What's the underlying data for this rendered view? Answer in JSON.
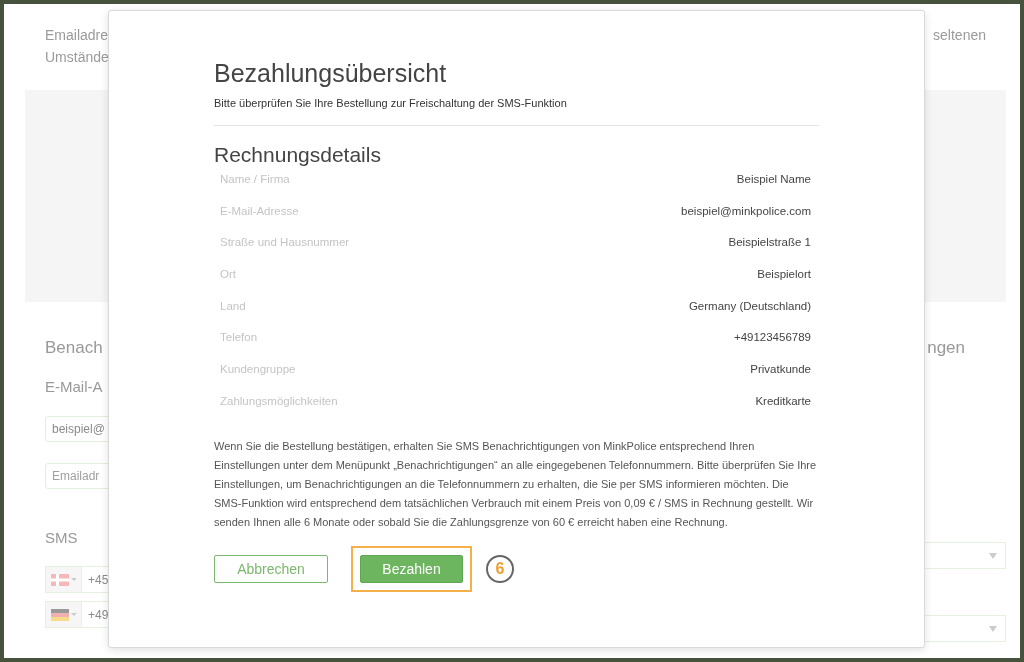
{
  "background": {
    "intro_left": [
      "Emailadre",
      "Umstände"
    ],
    "intro_right": "seltenen",
    "section_heading": "Benach",
    "section_heading_right": "ngen",
    "email_label": "E-Mail-A",
    "email_fields": [
      {
        "value": "beispiel@"
      },
      {
        "placeholder": "Emailadr"
      }
    ],
    "sms_label": "SMS",
    "phone_fields": [
      {
        "kind": "denmark",
        "value": "+45"
      },
      {
        "kind": "germany",
        "value": "+49"
      }
    ]
  },
  "dialog": {
    "title": "Bezahlungsübersicht",
    "subtitle": "Bitte überprüfen Sie Ihre Bestellung zur Freischaltung der SMS-Funktion",
    "section_title": "Rechnungsdetails",
    "details": [
      {
        "label": "Name / Firma",
        "value": "Beispiel Name"
      },
      {
        "label": "E-Mail-Adresse",
        "value": "beispiel@minkpolice.com"
      },
      {
        "label": "Straße und Hausnummer",
        "value": "Beispielstraße 1"
      },
      {
        "label": "Ort",
        "value": "Beispielort"
      },
      {
        "label": "Land",
        "value": "Germany (Deutschland)"
      },
      {
        "label": "Telefon",
        "value": "+49123456789"
      },
      {
        "label": "Kundengruppe",
        "value": "Privatkunde"
      },
      {
        "label": "Zahlungsmöglichkeiten",
        "value": "Kreditkarte"
      }
    ],
    "notice": "Wenn Sie die Bestellung bestätigen, erhalten Sie SMS Benachrichtigungen von MinkPolice entsprechend Ihren Einstellungen unter dem Menüpunkt „Benachrichtigungen“ an alle eingegebenen Telefonnummern. Bitte überprüfen Sie Ihre Einstellungen, um Benachrichtigungen an die Telefonnummern zu erhalten, die Sie per SMS informieren möchten. Die SMS-Funktion wird entsprechend dem tatsächlichen Verbrauch mit einem Preis von 0,09 € / SMS in Rechnung gestellt. Wir senden Ihnen alle 6 Monate oder sobald Sie die Zahlungsgrenze von 60 € erreicht haben eine Rechnung.",
    "buttons": [
      {
        "label": "Abbrechen",
        "kind": "secondary",
        "highlighted": false
      },
      {
        "label": "Bezahlen",
        "kind": "primary",
        "highlighted": true
      }
    ],
    "step_marker": "6"
  }
}
